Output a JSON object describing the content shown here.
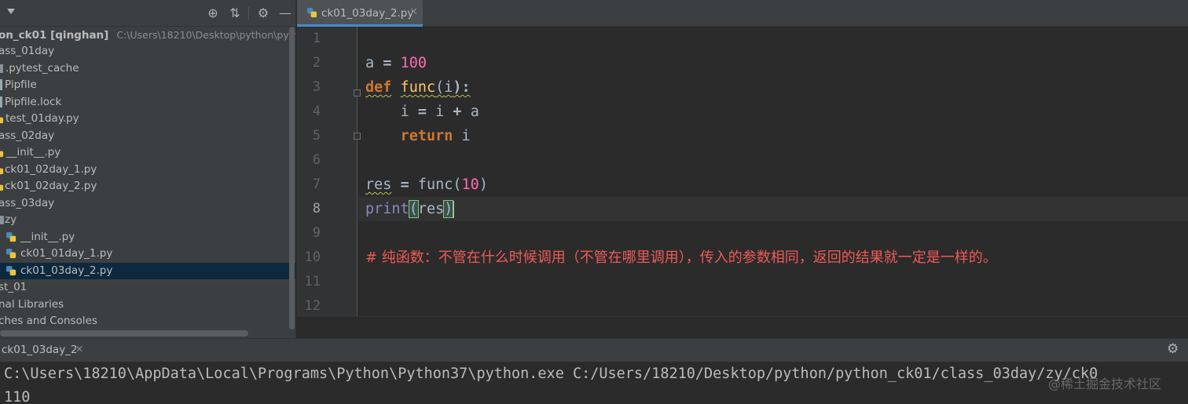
{
  "project": {
    "tree": [
      {
        "label": "on_ck01 [qinghan]",
        "path": "C:\\Users\\18210\\Desktop\\python\\python",
        "icon": "folder-icon"
      },
      {
        "label": "ass_01day",
        "icon": "folder-icon"
      },
      {
        "label": ".pytest_cache",
        "icon": "folder-icon"
      },
      {
        "label": "Pipfile",
        "icon": "file-icon"
      },
      {
        "label": "Pipfile.lock",
        "icon": "file-icon"
      },
      {
        "label": "test_01day.py",
        "icon": "python-file-icon"
      },
      {
        "label": "ass_02day",
        "icon": "folder-icon"
      },
      {
        "label": "__init__.py",
        "icon": "python-file-icon"
      },
      {
        "label": "ck01_02day_1.py",
        "icon": "python-file-icon"
      },
      {
        "label": "ck01_02day_2.py",
        "icon": "python-file-icon"
      },
      {
        "label": "ass_03day",
        "icon": "folder-icon"
      },
      {
        "label": "zy",
        "icon": "folder-icon"
      },
      {
        "label": "__init__.py",
        "icon": "python-file-icon"
      },
      {
        "label": "ck01_01day_1.py",
        "icon": "python-file-icon"
      },
      {
        "label": "ck01_03day_2.py",
        "icon": "python-file-icon",
        "selected": true
      },
      {
        "label": "st_01",
        "icon": "folder-icon"
      },
      {
        "label": "nal Libraries",
        "icon": "library-icon"
      },
      {
        "label": "ches and Consoles",
        "icon": "console-icon"
      }
    ]
  },
  "editor": {
    "tab_label": "ck01_03day_2.py",
    "line_numbers": [
      "1",
      "2",
      "3",
      "4",
      "5",
      "6",
      "7",
      "8",
      "9",
      "10",
      "11",
      "12"
    ],
    "current_line": 8,
    "code": {
      "l2": {
        "name": "a",
        "eq": "=",
        "value": "100"
      },
      "l3": {
        "kw": "def",
        "name": "func",
        "open": "(",
        "param": "i",
        "close": "):"
      },
      "l4": {
        "lhs": "i",
        "eq": "=",
        "a": "i",
        "plus": "+",
        "b": "a"
      },
      "l5": {
        "kw": "return",
        "val": "i"
      },
      "l7": {
        "name": "res",
        "eq": "=",
        "call": "func",
        "open": "(",
        "arg": "10",
        "close": ")"
      },
      "l8": {
        "call": "print",
        "open": "(",
        "arg": "res",
        "close": ")"
      },
      "l10": "# 纯函数：不管在什么时候调用（不管在哪里调用），传入的参数相同，返回的结果就一定是一样的。"
    }
  },
  "run": {
    "tab_label": "ck01_03day_2",
    "command": "C:\\Users\\18210\\AppData\\Local\\Programs\\Python\\Python37\\python.exe C:/Users/18210/Desktop/python/python_ck01/class_03day/zy/ck0",
    "output": "110"
  },
  "watermark": "@稀土掘金技术社区",
  "colors": {
    "panel_bg": "#3c3f41",
    "editor_bg": "#2b2b2b",
    "keyword": "#cc7832",
    "function": "#ffc66d",
    "number": "#ff6bb5",
    "comment": "#f05a55",
    "selection": "#0d293e"
  }
}
